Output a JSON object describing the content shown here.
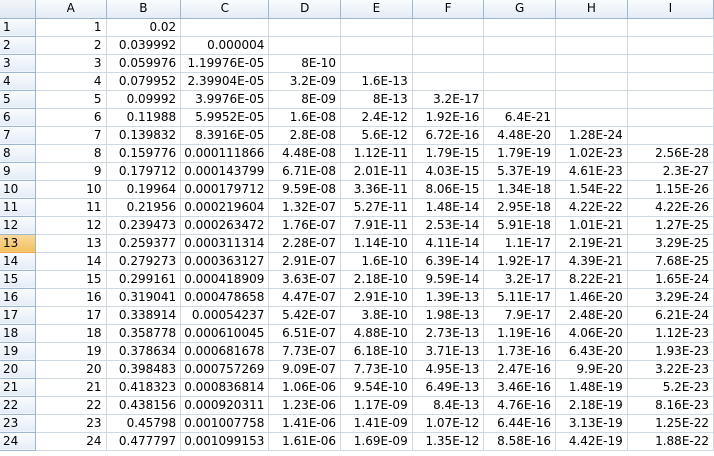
{
  "columns": [
    "A",
    "B",
    "C",
    "D",
    "E",
    "F",
    "G",
    "H",
    "I"
  ],
  "active_row": 13,
  "rows": [
    {
      "num": "1",
      "cells": [
        "1",
        "0.02",
        "",
        "",
        "",
        "",
        "",
        "",
        ""
      ]
    },
    {
      "num": "2",
      "cells": [
        "2",
        "0.039992",
        "0.000004",
        "",
        "",
        "",
        "",
        "",
        ""
      ]
    },
    {
      "num": "3",
      "cells": [
        "3",
        "0.059976",
        "1.19976E-05",
        "8E-10",
        "",
        "",
        "",
        "",
        ""
      ]
    },
    {
      "num": "4",
      "cells": [
        "4",
        "0.079952",
        "2.39904E-05",
        "3.2E-09",
        "1.6E-13",
        "",
        "",
        "",
        ""
      ]
    },
    {
      "num": "5",
      "cells": [
        "5",
        "0.09992",
        "3.9976E-05",
        "8E-09",
        "8E-13",
        "3.2E-17",
        "",
        "",
        ""
      ]
    },
    {
      "num": "6",
      "cells": [
        "6",
        "0.11988",
        "5.9952E-05",
        "1.6E-08",
        "2.4E-12",
        "1.92E-16",
        "6.4E-21",
        "",
        ""
      ]
    },
    {
      "num": "7",
      "cells": [
        "7",
        "0.139832",
        "8.3916E-05",
        "2.8E-08",
        "5.6E-12",
        "6.72E-16",
        "4.48E-20",
        "1.28E-24",
        ""
      ]
    },
    {
      "num": "8",
      "cells": [
        "8",
        "0.159776",
        "0.000111866",
        "4.48E-08",
        "1.12E-11",
        "1.79E-15",
        "1.79E-19",
        "1.02E-23",
        "2.56E-28"
      ]
    },
    {
      "num": "9",
      "cells": [
        "9",
        "0.179712",
        "0.000143799",
        "6.71E-08",
        "2.01E-11",
        "4.03E-15",
        "5.37E-19",
        "4.61E-23",
        "2.3E-27"
      ]
    },
    {
      "num": "10",
      "cells": [
        "10",
        "0.19964",
        "0.000179712",
        "9.59E-08",
        "3.36E-11",
        "8.06E-15",
        "1.34E-18",
        "1.54E-22",
        "1.15E-26"
      ]
    },
    {
      "num": "11",
      "cells": [
        "11",
        "0.21956",
        "0.000219604",
        "1.32E-07",
        "5.27E-11",
        "1.48E-14",
        "2.95E-18",
        "4.22E-22",
        "4.22E-26"
      ]
    },
    {
      "num": "12",
      "cells": [
        "12",
        "0.239473",
        "0.000263472",
        "1.76E-07",
        "7.91E-11",
        "2.53E-14",
        "5.91E-18",
        "1.01E-21",
        "1.27E-25"
      ]
    },
    {
      "num": "13",
      "cells": [
        "13",
        "0.259377",
        "0.000311314",
        "2.28E-07",
        "1.14E-10",
        "4.11E-14",
        "1.1E-17",
        "2.19E-21",
        "3.29E-25"
      ]
    },
    {
      "num": "14",
      "cells": [
        "14",
        "0.279273",
        "0.000363127",
        "2.91E-07",
        "1.6E-10",
        "6.39E-14",
        "1.92E-17",
        "4.39E-21",
        "7.68E-25"
      ]
    },
    {
      "num": "15",
      "cells": [
        "15",
        "0.299161",
        "0.000418909",
        "3.63E-07",
        "2.18E-10",
        "9.59E-14",
        "3.2E-17",
        "8.22E-21",
        "1.65E-24"
      ]
    },
    {
      "num": "16",
      "cells": [
        "16",
        "0.319041",
        "0.000478658",
        "4.47E-07",
        "2.91E-10",
        "1.39E-13",
        "5.11E-17",
        "1.46E-20",
        "3.29E-24"
      ]
    },
    {
      "num": "17",
      "cells": [
        "17",
        "0.338914",
        "0.00054237",
        "5.42E-07",
        "3.8E-10",
        "1.98E-13",
        "7.9E-17",
        "2.48E-20",
        "6.21E-24"
      ]
    },
    {
      "num": "18",
      "cells": [
        "18",
        "0.358778",
        "0.000610045",
        "6.51E-07",
        "4.88E-10",
        "2.73E-13",
        "1.19E-16",
        "4.06E-20",
        "1.12E-23"
      ]
    },
    {
      "num": "19",
      "cells": [
        "19",
        "0.378634",
        "0.000681678",
        "7.73E-07",
        "6.18E-10",
        "3.71E-13",
        "1.73E-16",
        "6.43E-20",
        "1.93E-23"
      ]
    },
    {
      "num": "20",
      "cells": [
        "20",
        "0.398483",
        "0.000757269",
        "9.09E-07",
        "7.73E-10",
        "4.95E-13",
        "2.47E-16",
        "9.9E-20",
        "3.22E-23"
      ]
    },
    {
      "num": "21",
      "cells": [
        "21",
        "0.418323",
        "0.000836814",
        "1.06E-06",
        "9.54E-10",
        "6.49E-13",
        "3.46E-16",
        "1.48E-19",
        "5.2E-23"
      ]
    },
    {
      "num": "22",
      "cells": [
        "22",
        "0.438156",
        "0.000920311",
        "1.23E-06",
        "1.17E-09",
        "8.4E-13",
        "4.76E-16",
        "2.18E-19",
        "8.16E-23"
      ]
    },
    {
      "num": "23",
      "cells": [
        "23",
        "0.45798",
        "0.001007758",
        "1.41E-06",
        "1.41E-09",
        "1.07E-12",
        "6.44E-16",
        "3.13E-19",
        "1.25E-22"
      ]
    },
    {
      "num": "24",
      "cells": [
        "24",
        "0.477797",
        "0.001099153",
        "1.61E-06",
        "1.69E-09",
        "1.35E-12",
        "8.58E-16",
        "4.42E-19",
        "1.88E-22"
      ]
    }
  ]
}
